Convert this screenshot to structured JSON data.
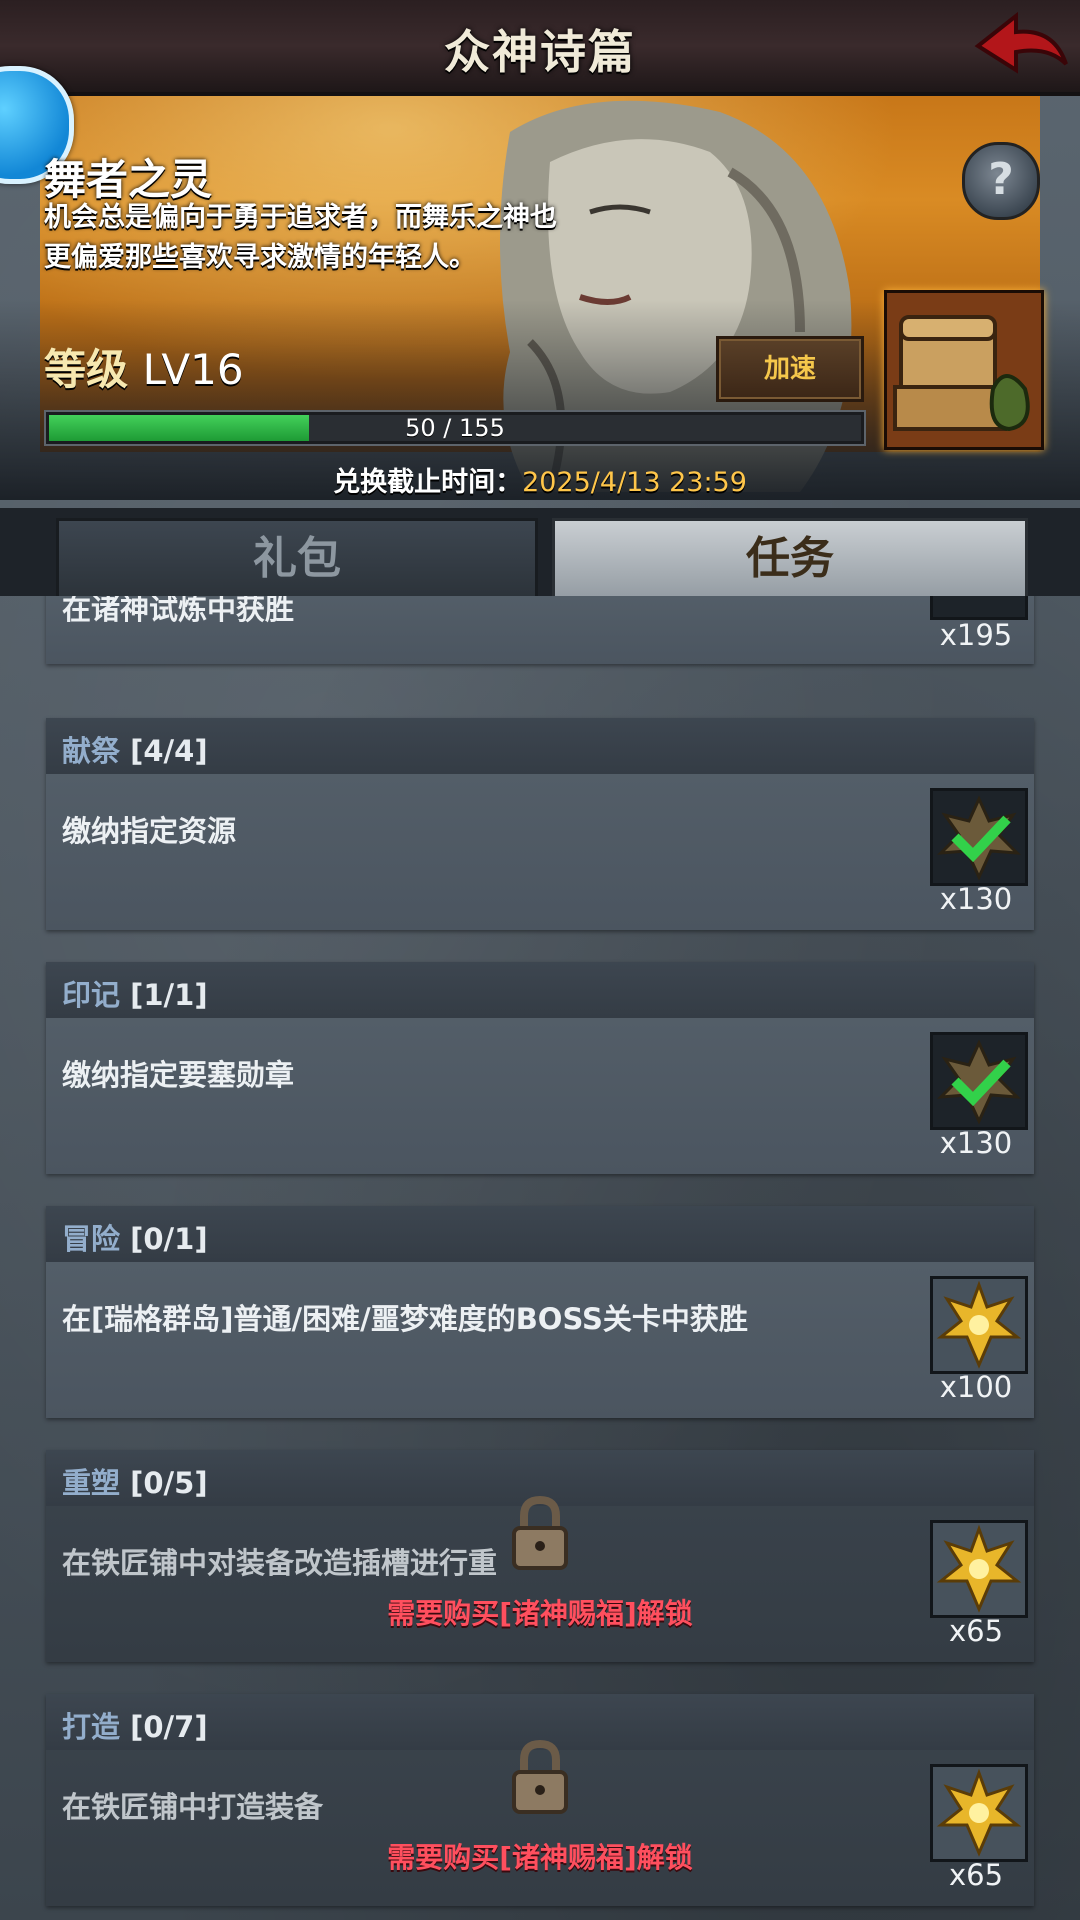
{
  "header": {
    "title": "众神诗篇"
  },
  "banner": {
    "spirit_name": "舞者之灵",
    "desc_line1": "机会总是偏向于勇于追求者，而舞乐之神也",
    "desc_line2": "更偏爱那些喜欢寻求激情的年轻人。",
    "level_label": "等级",
    "level_value": "LV16",
    "speed_button": "加速",
    "progress_text": "50 / 155",
    "progress_fraction": 0.32,
    "deadline_label": "兑换截止时间：",
    "deadline_value": "2025/4/13 23:59"
  },
  "tabs": {
    "gift": "礼包",
    "task": "任务"
  },
  "tasks": [
    {
      "title": "",
      "progress": "",
      "desc": "在诸神试炼中获胜",
      "reward": "x195",
      "icon": "green-check-medal-icon",
      "locked": false
    },
    {
      "title": "献祭",
      "progress": "[4/4]",
      "desc": "缴纳指定资源",
      "reward": "x130",
      "icon": "green-check-medal-icon",
      "locked": false
    },
    {
      "title": "印记",
      "progress": "[1/1]",
      "desc": "缴纳指定要塞勋章",
      "reward": "x130",
      "icon": "green-check-medal-icon",
      "locked": false
    },
    {
      "title": "冒险",
      "progress": "[0/1]",
      "desc": "在[瑞格群岛]普通/困难/噩梦难度的BOSS关卡中获胜",
      "reward": "x100",
      "icon": "gold-emblem-icon",
      "locked": false
    },
    {
      "title": "重塑",
      "progress": "[0/5]",
      "desc": "在铁匠铺中对装备改造插槽进行重",
      "reward": "x65",
      "icon": "gold-emblem-icon",
      "locked": true,
      "lock_text": "需要购买[诸神赐福]解锁"
    },
    {
      "title": "打造",
      "progress": "[0/7]",
      "desc": "在铁匠铺中打造装备",
      "reward": "x65",
      "icon": "gold-emblem-icon",
      "locked": true,
      "lock_text": "需要购买[诸神赐福]解锁"
    }
  ]
}
